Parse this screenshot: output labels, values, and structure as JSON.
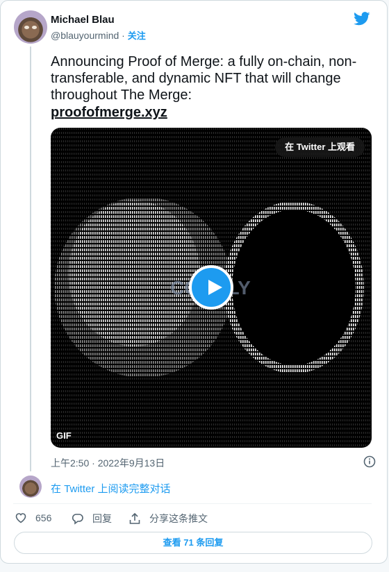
{
  "author": {
    "name": "Michael Blau",
    "handle": "@blauyourmind",
    "separator": "·",
    "follow_label": "关注"
  },
  "tweet": {
    "text": "Announcing Proof of Merge: a fully on-chain, non-transferable, and dynamic NFT that will change throughout The Merge:",
    "link": "proofofmerge.xyz"
  },
  "media": {
    "watch_label": "在 Twitter 上观看",
    "badge": "GIF",
    "watermark": "CORALY"
  },
  "meta": {
    "timestamp": "上午2:50 · 2022年9月13日"
  },
  "thread": {
    "read_label": "在 Twitter 上阅读完整对话"
  },
  "actions": {
    "like_count": "656",
    "reply_label": "回复",
    "share_label": "分享这条推文"
  },
  "footer": {
    "view_replies_label": "查看 71 条回复"
  },
  "colors": {
    "accent": "#1d9bf0",
    "text": "#0f1419",
    "muted": "#536471"
  },
  "icons": [
    "twitter-bird-icon",
    "info-icon",
    "heart-icon",
    "reply-icon",
    "share-icon",
    "play-icon"
  ]
}
